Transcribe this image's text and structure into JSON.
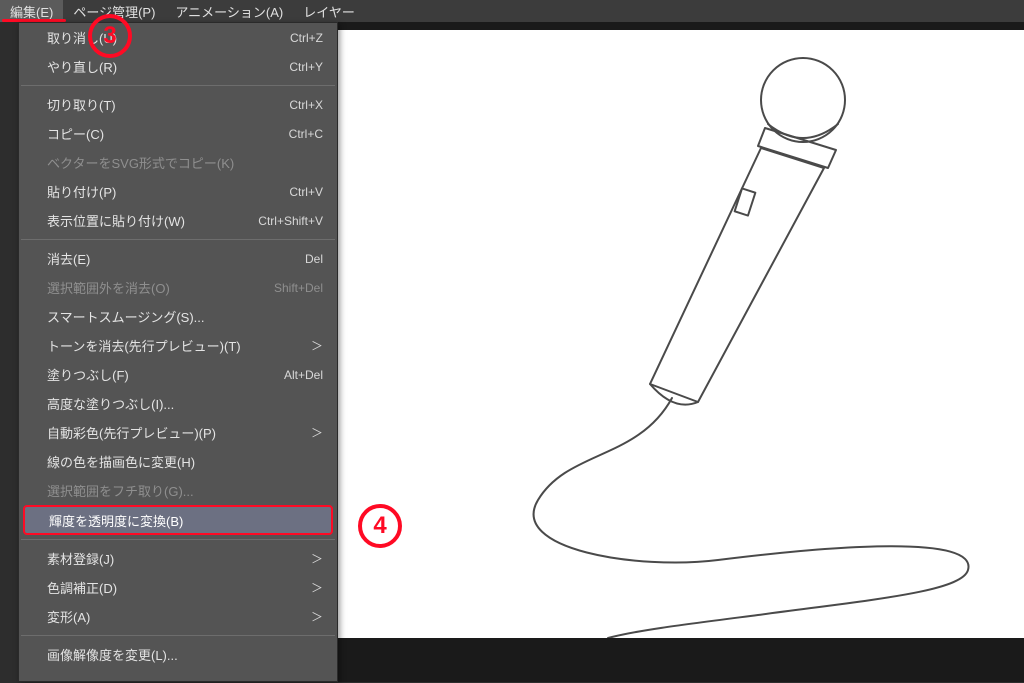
{
  "menubar": {
    "items": [
      {
        "label": "編集(E)",
        "open": true
      },
      {
        "label": "ページ管理(P)",
        "open": false
      },
      {
        "label": "アニメーション(A)",
        "open": false
      },
      {
        "label": "レイヤー",
        "open": false
      }
    ]
  },
  "menu": {
    "items": [
      {
        "type": "item",
        "label": "取り消し(U)",
        "accel": "Ctrl+Z",
        "enabled": true
      },
      {
        "type": "item",
        "label": "やり直し(R)",
        "accel": "Ctrl+Y",
        "enabled": true
      },
      {
        "type": "sep"
      },
      {
        "type": "item",
        "label": "切り取り(T)",
        "accel": "Ctrl+X",
        "enabled": true
      },
      {
        "type": "item",
        "label": "コピー(C)",
        "accel": "Ctrl+C",
        "enabled": true
      },
      {
        "type": "item",
        "label": "ベクターをSVG形式でコピー(K)",
        "enabled": false
      },
      {
        "type": "item",
        "label": "貼り付け(P)",
        "accel": "Ctrl+V",
        "enabled": true
      },
      {
        "type": "item",
        "label": "表示位置に貼り付け(W)",
        "accel": "Ctrl+Shift+V",
        "enabled": true
      },
      {
        "type": "sep"
      },
      {
        "type": "item",
        "label": "消去(E)",
        "accel": "Del",
        "enabled": true
      },
      {
        "type": "item",
        "label": "選択範囲外を消去(O)",
        "accel": "Shift+Del",
        "enabled": false
      },
      {
        "type": "item",
        "label": "スマートスムージング(S)...",
        "enabled": true
      },
      {
        "type": "item",
        "label": "トーンを消去(先行プレビュー)(T)",
        "submenu": true,
        "enabled": true
      },
      {
        "type": "item",
        "label": "塗りつぶし(F)",
        "accel": "Alt+Del",
        "enabled": true
      },
      {
        "type": "item",
        "label": "高度な塗りつぶし(I)...",
        "enabled": true
      },
      {
        "type": "item",
        "label": "自動彩色(先行プレビュー)(P)",
        "submenu": true,
        "enabled": true
      },
      {
        "type": "item",
        "label": "線の色を描画色に変更(H)",
        "enabled": true
      },
      {
        "type": "item",
        "label": "選択範囲をフチ取り(G)...",
        "enabled": false
      },
      {
        "type": "item",
        "label": "輝度を透明度に変換(B)",
        "enabled": true,
        "highlight": true
      },
      {
        "type": "sep"
      },
      {
        "type": "item",
        "label": "素材登録(J)",
        "submenu": true,
        "enabled": true
      },
      {
        "type": "item",
        "label": "色調補正(D)",
        "submenu": true,
        "enabled": true
      },
      {
        "type": "item",
        "label": "変形(A)",
        "submenu": true,
        "enabled": true
      },
      {
        "type": "sep"
      },
      {
        "type": "item",
        "label": "画像解像度を変更(L)...",
        "enabled": true
      }
    ]
  },
  "callouts": {
    "c3": "3",
    "c4": "4"
  },
  "arrow_glyph": "＞",
  "canvas": {
    "description": "microphone-lineart"
  }
}
